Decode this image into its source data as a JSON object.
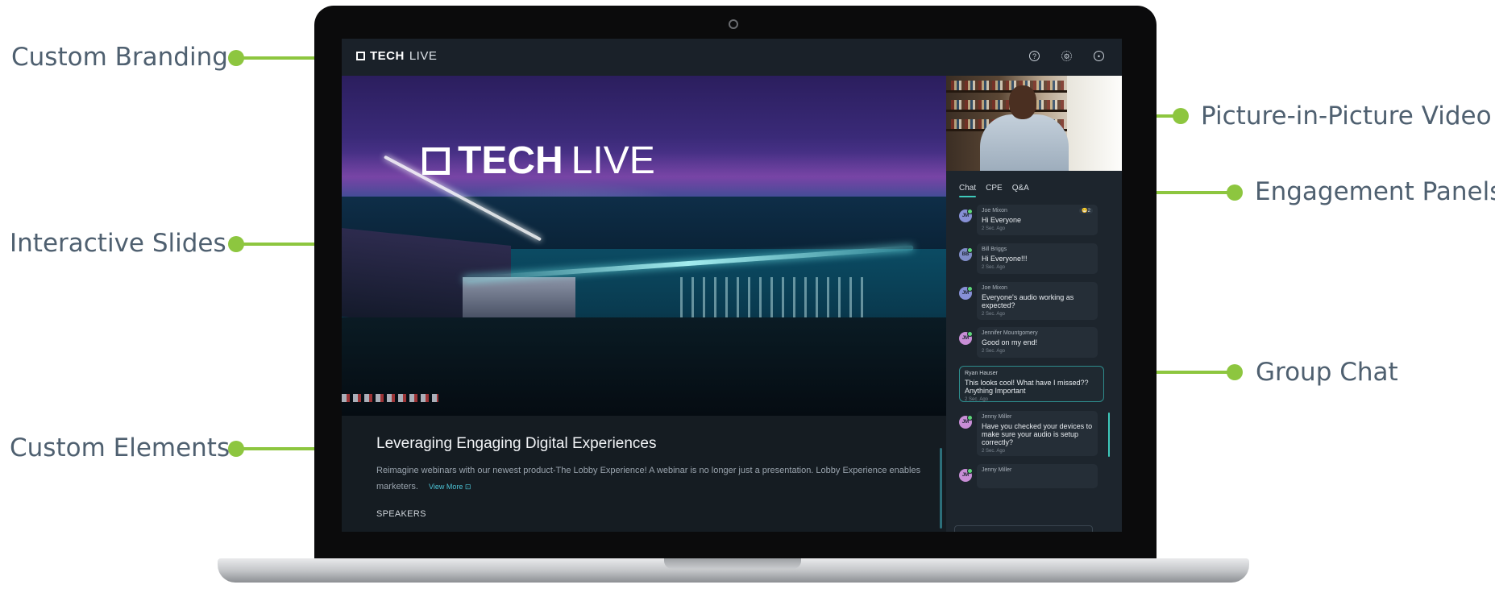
{
  "annotations": {
    "custom_branding": "Custom Branding",
    "interactive_slides": "Interactive Slides",
    "custom_elements": "Custom Elements",
    "pip_video": "Picture-in-Picture Video",
    "engagement_panels": "Engagement Panels",
    "group_chat": "Group Chat"
  },
  "colors": {
    "accent": "#8dc63f",
    "teal": "#3ec9bb",
    "screen_bg": "#161d24"
  },
  "app": {
    "logo_bold": "TECH",
    "logo_thin": "LIVE",
    "topbar_icons": [
      "help-icon",
      "settings-icon",
      "profile-icon"
    ]
  },
  "slide": {
    "logo_bold": "TECH",
    "logo_thin": "LIVE"
  },
  "event": {
    "title": "Leveraging Engaging Digital Experiences",
    "description": "Reimagine webinars with our newest product-The Lobby Experience! A webinar is no longer just a presentation. Lobby Experience enables marketers.",
    "view_more": "View More",
    "speakers_heading": "SPEAKERS"
  },
  "panel": {
    "tabs": [
      "Chat",
      "CPE",
      "Q&A"
    ],
    "active_tab": "Chat",
    "messages": [
      {
        "initials": "JM",
        "name": "Joe Mixon",
        "text": "Hi Everyone",
        "time": "2 Sec. Ago",
        "reaction": "😁2",
        "avatar_color": "#8790d6"
      },
      {
        "initials": "BB",
        "name": "Bill Briggs",
        "text": "Hi Everyone!!!",
        "time": "2 Sec. Ago",
        "avatar_color": "#7f8cc7"
      },
      {
        "initials": "JM",
        "name": "Joe Mixon",
        "text": "Everyone's audio working as expected?",
        "time": "2 Sec. Ago",
        "avatar_color": "#8790d6"
      },
      {
        "initials": "JM",
        "name": "Jennifer Mountgomery",
        "text": "Good on my end!",
        "time": "2 Sec. Ago",
        "avatar_color": "#c88ed6"
      },
      {
        "initials": "",
        "name": "Ryan Hauser",
        "text": "This looks cool! What have I missed?? Anything Important",
        "time": "2 Sec. Ago",
        "highlight": true
      },
      {
        "initials": "JM",
        "name": "Jenny Miller",
        "text": "Have you checked your devices to make sure your audio is setup correctly?",
        "time": "2 Sec. Ago",
        "avatar_color": "#c88ed6"
      },
      {
        "initials": "JM",
        "name": "Jenny Miller",
        "text": "",
        "time": "",
        "avatar_color": "#c88ed6"
      }
    ]
  }
}
